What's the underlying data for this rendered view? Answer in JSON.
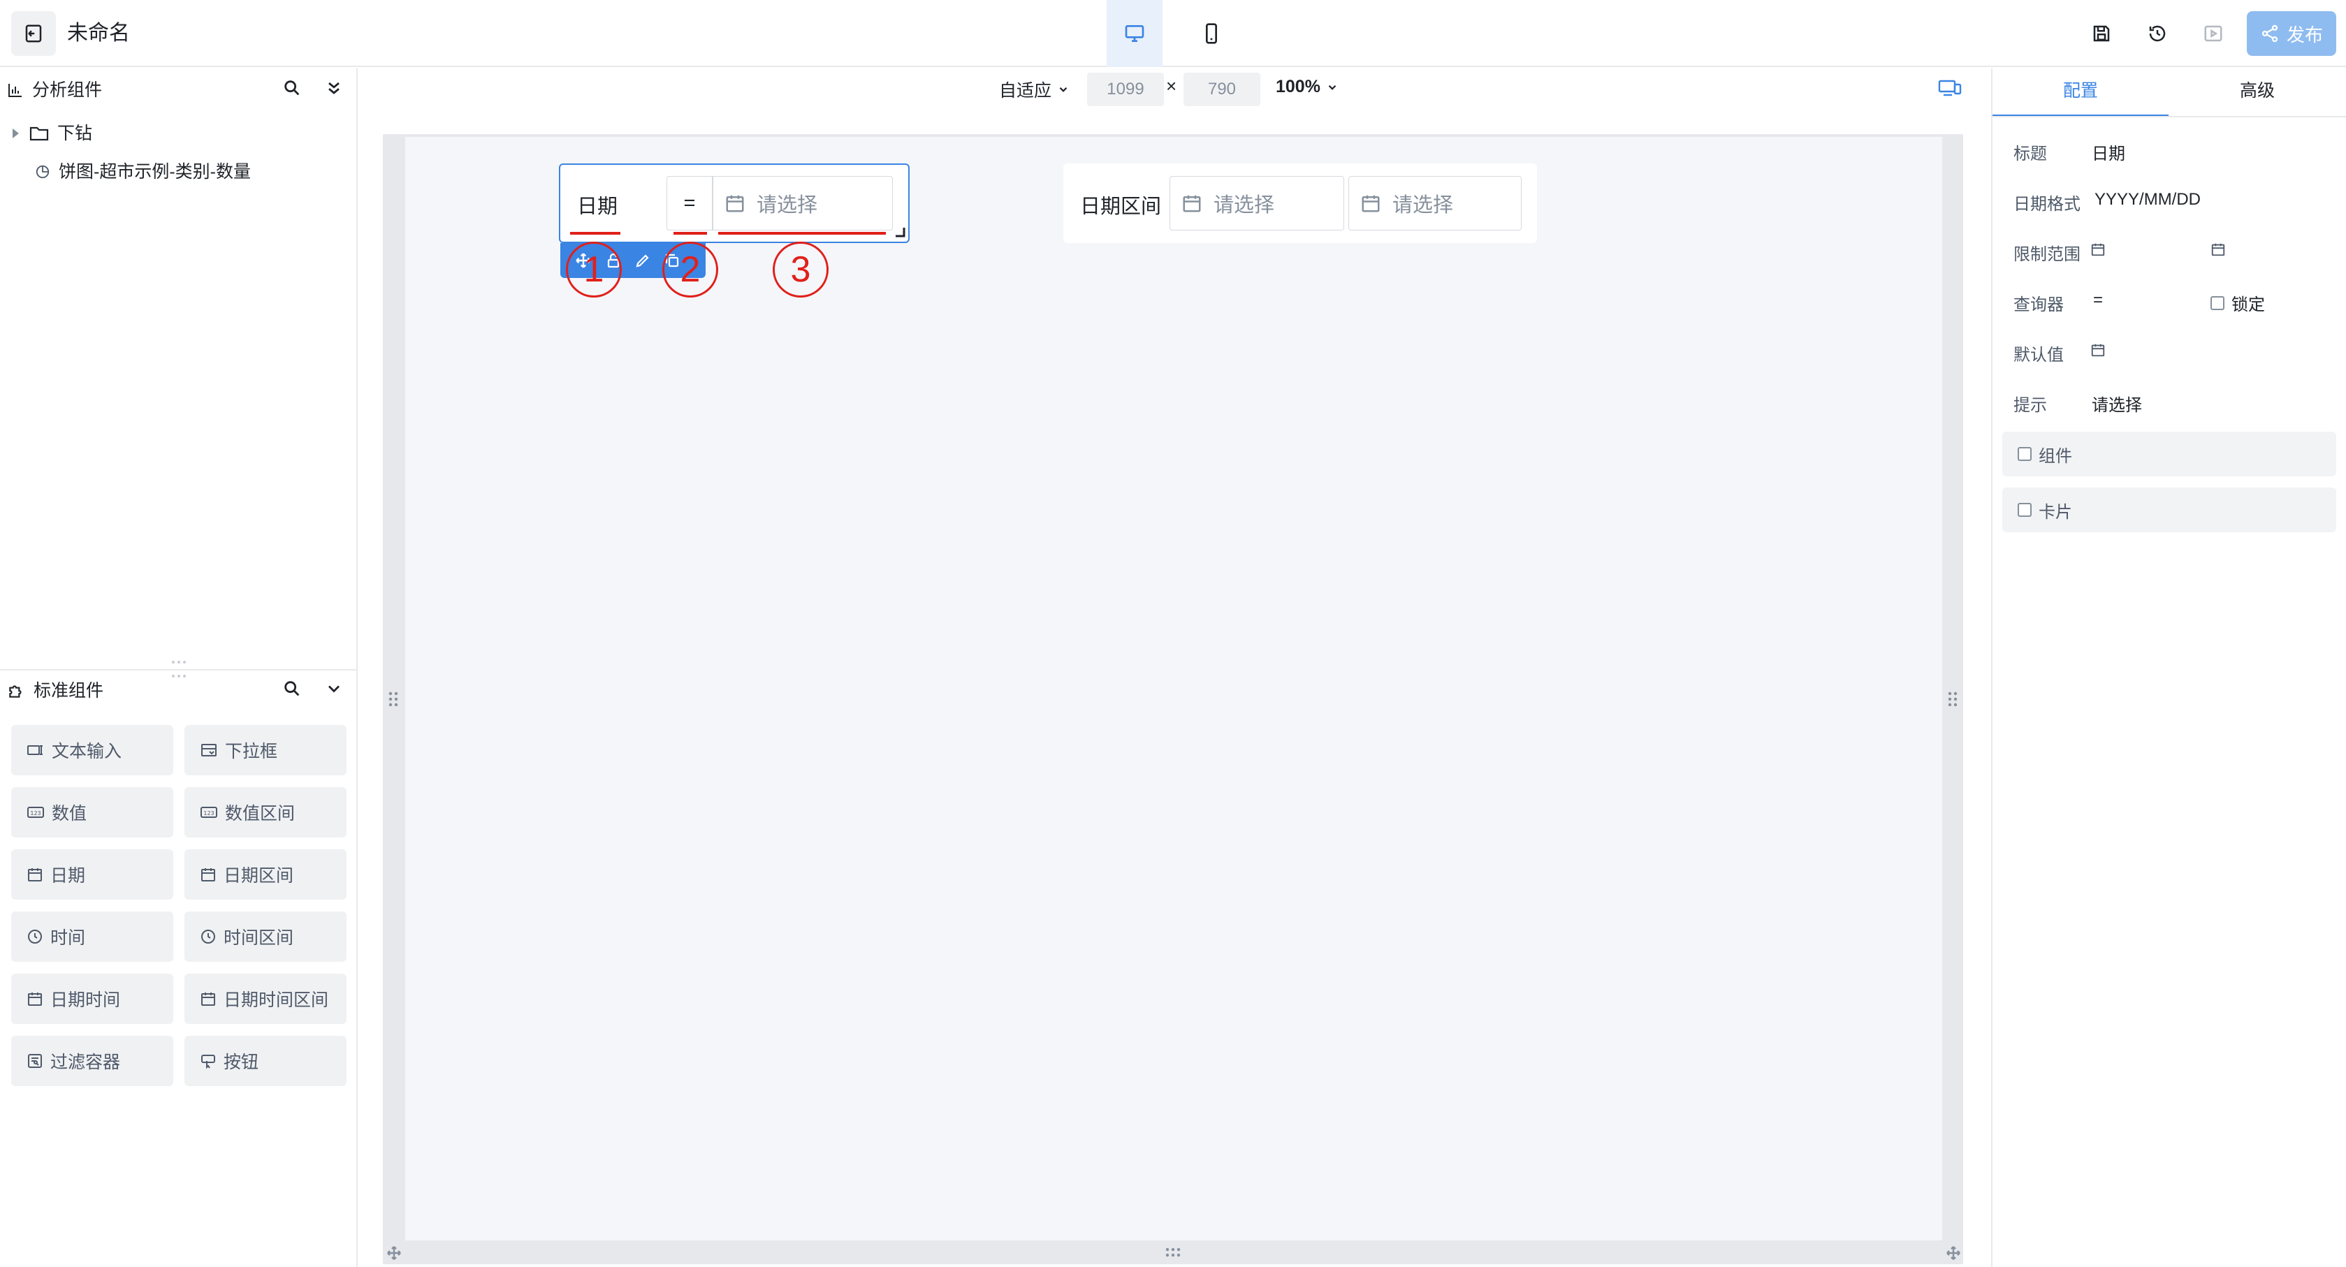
{
  "header": {
    "title": "未命名",
    "publish_label": "发布"
  },
  "left_panel": {
    "analysis_title": "分析组件",
    "tree": [
      {
        "label": "下钻"
      },
      {
        "label": "饼图-超市示例-类别-数量"
      }
    ],
    "standard_title": "标准组件",
    "components": [
      {
        "label": "文本输入"
      },
      {
        "label": "下拉框"
      },
      {
        "label": "数值"
      },
      {
        "label": "数值区间"
      },
      {
        "label": "日期"
      },
      {
        "label": "日期区间"
      },
      {
        "label": "时间"
      },
      {
        "label": "时间区间"
      },
      {
        "label": "日期时间"
      },
      {
        "label": "日期时间区间"
      },
      {
        "label": "过滤容器"
      },
      {
        "label": "按钮"
      }
    ]
  },
  "canvas_toolbar": {
    "layout_mode": "自适应",
    "width": "1099",
    "times": "×",
    "height": "790",
    "zoom": "100%"
  },
  "canvas": {
    "date_widget": {
      "label": "日期",
      "operator": "=",
      "placeholder": "请选择"
    },
    "range_widget": {
      "label": "日期区间",
      "start_placeholder": "请选择",
      "end_placeholder": "请选择"
    },
    "annotations": [
      "1",
      "2",
      "3"
    ]
  },
  "right_panel": {
    "tabs": [
      {
        "label": "配置",
        "active": true
      },
      {
        "label": "高级",
        "active": false
      }
    ],
    "props": {
      "title_label": "标题",
      "title_value": "日期",
      "format_label": "日期格式",
      "format_value": "YYYY/MM/DD",
      "range_label": "限制范围",
      "query_label": "查询器",
      "query_value": "=",
      "lock_label": "锁定",
      "default_label": "默认值",
      "hint_label": "提示",
      "hint_value": "请选择"
    },
    "sections": [
      {
        "label": "组件"
      },
      {
        "label": "卡片"
      }
    ]
  },
  "colors": {
    "accent": "#3a84e4",
    "publish_bg": "#8fbcf0",
    "annotation": "#e0201a",
    "canvas_bg": "#f5f6fa"
  }
}
